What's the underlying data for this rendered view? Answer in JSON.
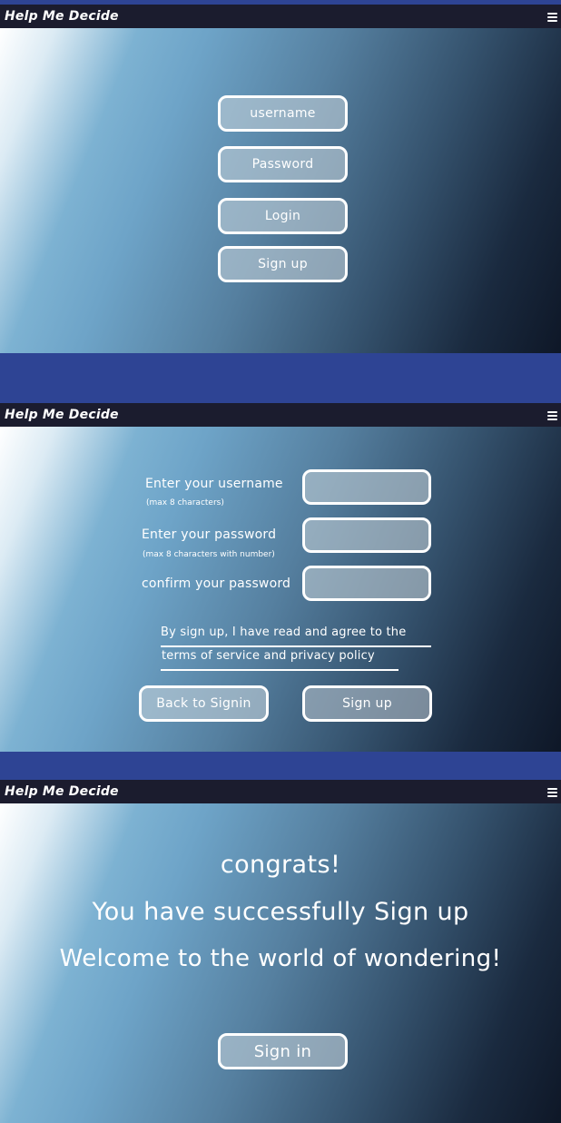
{
  "app_title": "Help Me Decide",
  "login_screen": {
    "username": "username",
    "password": "Password",
    "login": "Login",
    "signup": "Sign up"
  },
  "signup_screen": {
    "username_label": "Enter your username",
    "username_hint": "(max 8 characters)",
    "password_label": "Enter your password",
    "password_hint": "(max 8 characters with number)",
    "confirm_label": "confirm your password",
    "username_value": "",
    "password_value": "",
    "confirm_value": "",
    "terms_line1": "By sign up, I have read and agree to the",
    "terms_line2": "terms of service and privacy policy",
    "back_button": "Back to Signin",
    "signup_button": "Sign up"
  },
  "success_screen": {
    "line1": "congrats!",
    "line2": "You have successfully Sign up",
    "line3": "Welcome to the world of wondering!",
    "signin_button": "Sign in"
  }
}
